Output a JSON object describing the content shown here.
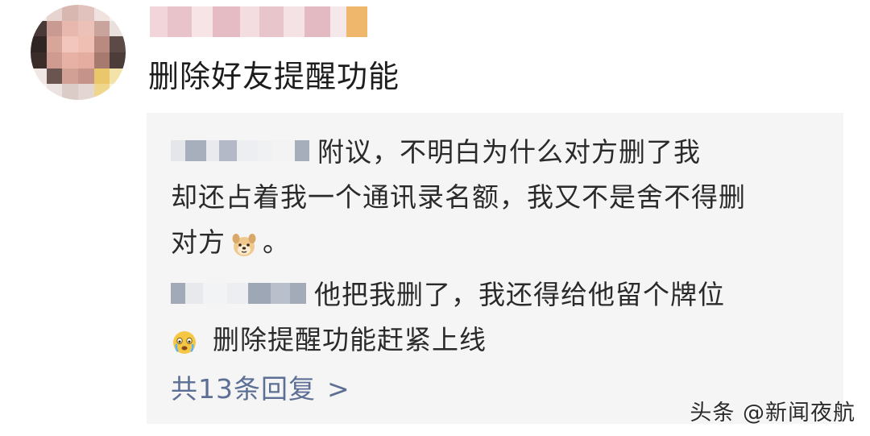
{
  "post": {
    "title": "删除好友提醒功能"
  },
  "replies": [
    {
      "text_line1": "附议，不明白为什么对方删了我",
      "text_line2": "却还占着我一个通讯录名额，我又不是舍不得删",
      "text_line3_before": "对方",
      "emoji": "dog-face-emoji",
      "text_line3_after": "。"
    },
    {
      "text_line1": "他把我删了，我还得给他留个牌位",
      "emoji": "crying-face-emoji",
      "text_line2": "删除提醒功能赶紧上线"
    }
  ],
  "more_replies": {
    "label": "共13条回复",
    "chevron": ">"
  },
  "watermark": {
    "text": "头条 @新闻夜航"
  },
  "colors": {
    "panel_bg": "#f5f5f5",
    "link": "#5d6f94",
    "text": "#2a2a2a"
  }
}
